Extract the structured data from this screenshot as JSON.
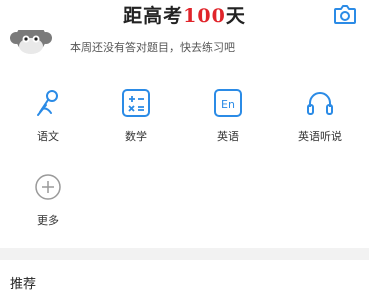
{
  "header": {
    "title_prefix": "距高考",
    "title_number": "100",
    "title_suffix": "天",
    "camera_icon": "camera-icon"
  },
  "motto": {
    "avatar_icon": "monkey-avatar",
    "text": "本周还没有答对题目，快去练习吧"
  },
  "subjects": [
    {
      "label": "语文",
      "icon": "chinese-icon"
    },
    {
      "label": "数学",
      "icon": "math-icon"
    },
    {
      "label": "英语",
      "icon": "english-icon"
    },
    {
      "label": "英语听说",
      "icon": "headphones-icon"
    },
    {
      "label": "更多",
      "icon": "plus-circle-icon"
    }
  ],
  "recommend": {
    "title": "推荐"
  },
  "colors": {
    "accent": "#2b8be6",
    "highlight": "#e0242a",
    "band": "#f2f2f2"
  }
}
